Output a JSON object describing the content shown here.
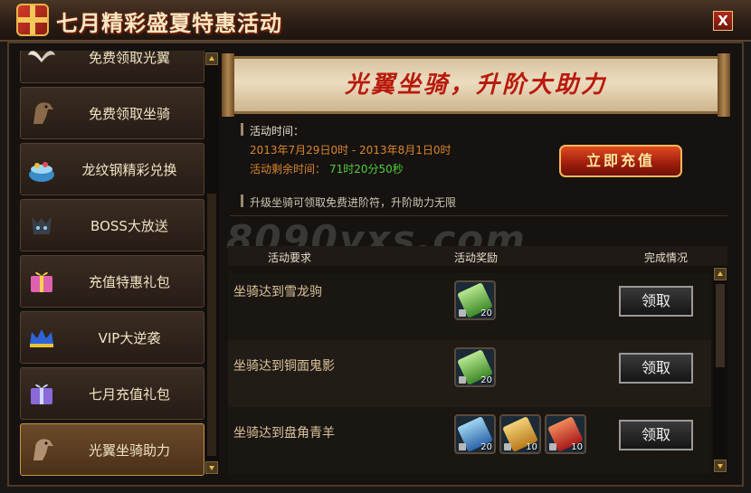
{
  "window": {
    "title": "七月精彩盛夏特惠活动",
    "close": "X"
  },
  "sidebar": {
    "items": [
      {
        "label": "免费领取光翼",
        "icon": "wings-icon"
      },
      {
        "label": "免费领取坐骑",
        "icon": "horse-icon"
      },
      {
        "label": "龙纹钢精彩兑换",
        "icon": "ingot-basket-icon"
      },
      {
        "label": "BOSS大放送",
        "icon": "boss-icon"
      },
      {
        "label": "充值特惠礼包",
        "icon": "gift-box-icon"
      },
      {
        "label": "VIP大逆袭",
        "icon": "crown-icon"
      },
      {
        "label": "七月充值礼包",
        "icon": "gift-box-icon"
      },
      {
        "label": "光翼坐骑助力",
        "icon": "horse-icon",
        "active": true
      }
    ]
  },
  "banner": {
    "text": "光翼坐骑，升阶大助力"
  },
  "event": {
    "time_header": "活动时间：",
    "time_range": "2013年7月29日0时 - 2013年8月1日0时",
    "remaining_label": "活动剩余时间：",
    "remaining_value": "71时20分50秒",
    "recharge_button": "立即充值",
    "tip": "升级坐骑可领取免费进阶符，升阶助力无限"
  },
  "watermark": "8090yxs.com",
  "table": {
    "headers": [
      "活动要求",
      "活动奖励",
      "完成情况"
    ],
    "rows": [
      {
        "requirement": "坐骑达到雪龙驹",
        "rewards": [
          {
            "qty": "20",
            "icon": "green-scroll-icon"
          }
        ],
        "action": "领取"
      },
      {
        "requirement": "坐骑达到铜面鬼影",
        "rewards": [
          {
            "qty": "20",
            "icon": "green-scroll-icon"
          }
        ],
        "action": "领取"
      },
      {
        "requirement": "坐骑达到盘角青羊",
        "rewards": [
          {
            "qty": "20",
            "icon": "blue-token-icon"
          },
          {
            "qty": "10",
            "icon": "golden-scroll-icon"
          },
          {
            "qty": "10",
            "icon": "red-wand-icon"
          }
        ],
        "action": "领取"
      }
    ]
  },
  "colors": {
    "accent_orange": "#d8872a",
    "remaining_green": "#4fcf3a",
    "banner_red": "#b81a0c"
  }
}
